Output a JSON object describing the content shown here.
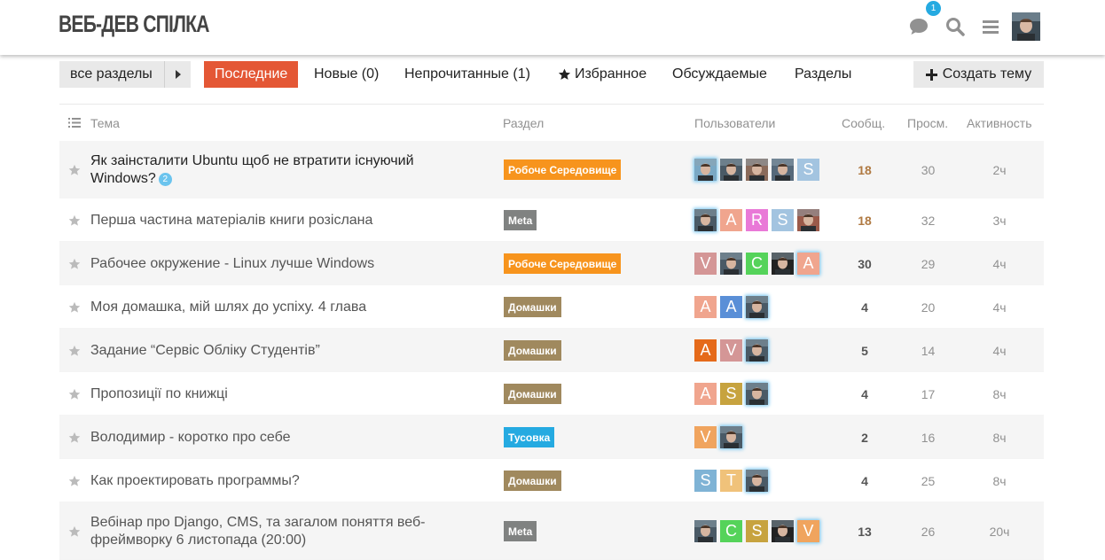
{
  "site": {
    "title": "ВЕБ-ДЕВ СПІЛКА",
    "notification_count": "1"
  },
  "nav": {
    "category_dropdown": "все разделы",
    "items": [
      {
        "label": "Последние",
        "active": true
      },
      {
        "label": "Новые (0)",
        "active": false
      },
      {
        "label": "Непрочитанные (1)",
        "active": false
      },
      {
        "label": "Избранное",
        "active": false
      },
      {
        "label": "Обсуждаемые",
        "active": false
      },
      {
        "label": "Разделы",
        "active": false
      }
    ],
    "create_topic": "Создать тему"
  },
  "table": {
    "headers": {
      "topic": "Тема",
      "category": "Раздел",
      "users": "Пользователи",
      "posts": "Сообщ.",
      "views": "Просм.",
      "activity": "Активность"
    },
    "rows": [
      {
        "title": "Як заінсталити Ubuntu щоб не втратити існуючий Windows?",
        "unread": "2",
        "category": "Робоче Середовище",
        "cat_color": "#f7941d",
        "users": [
          {
            "t": "photo",
            "c": "#7aa8c4",
            "hl": true
          },
          {
            "t": "photo",
            "c": "#4a5a66"
          },
          {
            "t": "photo",
            "c": "#8a6a5a"
          },
          {
            "t": "photo",
            "c": "#56697a"
          },
          {
            "t": "letter",
            "l": "S",
            "c": "#a3c4e0"
          }
        ],
        "posts": "18",
        "hot": true,
        "views": "30",
        "activity": "2ч"
      },
      {
        "title": "Перша частина матеріалів книги розіслана",
        "category": "Meta",
        "cat_color": "#808281",
        "users": [
          {
            "t": "photo",
            "c": "#4a5a66",
            "hl": true
          },
          {
            "t": "letter",
            "l": "A",
            "c": "#f0a58e"
          },
          {
            "t": "letter",
            "l": "R",
            "c": "#e979d7"
          },
          {
            "t": "letter",
            "l": "S",
            "c": "#a3c4e0"
          },
          {
            "t": "photo",
            "c": "#9a5a4a"
          }
        ],
        "posts": "18",
        "hot": true,
        "views": "32",
        "activity": "3ч"
      },
      {
        "title": "Рабочее окружение - Linux лучше Windows",
        "category": "Робоче Середовище",
        "cat_color": "#f7941d",
        "users": [
          {
            "t": "letter",
            "l": "V",
            "c": "#d49696"
          },
          {
            "t": "photo",
            "c": "#4a5a66"
          },
          {
            "t": "letter",
            "l": "C",
            "c": "#55d35a"
          },
          {
            "t": "photo",
            "c": "#222222"
          },
          {
            "t": "letter",
            "l": "A",
            "c": "#f0a58e",
            "hl": true
          }
        ],
        "posts": "30",
        "hot": false,
        "views": "29",
        "activity": "4ч"
      },
      {
        "title": "Моя домашка, мій шлях до успіху. 4 глава",
        "category": "Домашки",
        "cat_color": "#a0895e",
        "users": [
          {
            "t": "letter",
            "l": "A",
            "c": "#f0a58e"
          },
          {
            "t": "letter",
            "l": "A",
            "c": "#5a8fd7"
          },
          {
            "t": "photo",
            "c": "#4a5a66",
            "hl": true
          }
        ],
        "posts": "4",
        "hot": false,
        "views": "20",
        "activity": "4ч"
      },
      {
        "title": "Задание “Сервіс Обліку Студентів”",
        "category": "Домашки",
        "cat_color": "#a0895e",
        "users": [
          {
            "t": "letter",
            "l": "A",
            "c": "#e56a1a"
          },
          {
            "t": "letter",
            "l": "V",
            "c": "#d49696"
          },
          {
            "t": "photo",
            "c": "#4a5a66",
            "hl": true
          }
        ],
        "posts": "5",
        "hot": false,
        "views": "14",
        "activity": "4ч"
      },
      {
        "title": "Пропозиції по книжці",
        "category": "Домашки",
        "cat_color": "#a0895e",
        "users": [
          {
            "t": "letter",
            "l": "A",
            "c": "#f0a58e"
          },
          {
            "t": "letter",
            "l": "S",
            "c": "#c7a33f"
          },
          {
            "t": "photo",
            "c": "#4a5a66",
            "hl": true
          }
        ],
        "posts": "4",
        "hot": false,
        "views": "17",
        "activity": "8ч"
      },
      {
        "title": "Володимир - коротко про себе",
        "category": "Тусовка",
        "cat_color": "#25aae1",
        "users": [
          {
            "t": "letter",
            "l": "V",
            "c": "#f0a45e"
          },
          {
            "t": "photo",
            "c": "#4a5a66",
            "hl": true
          }
        ],
        "posts": "2",
        "hot": false,
        "views": "16",
        "activity": "8ч"
      },
      {
        "title": "Как проектировать программы?",
        "category": "Домашки",
        "cat_color": "#a0895e",
        "users": [
          {
            "t": "letter",
            "l": "S",
            "c": "#7fb3d5"
          },
          {
            "t": "letter",
            "l": "T",
            "c": "#f0c27a"
          },
          {
            "t": "photo",
            "c": "#4a5a66",
            "hl": true
          }
        ],
        "posts": "4",
        "hot": false,
        "views": "25",
        "activity": "8ч"
      },
      {
        "title": "Вебінар про Django, CMS, та загалом поняття веб-фреймворку 6 листопада (20:00)",
        "category": "Meta",
        "cat_color": "#808281",
        "users": [
          {
            "t": "photo",
            "c": "#4a5a66"
          },
          {
            "t": "letter",
            "l": "C",
            "c": "#55d35a"
          },
          {
            "t": "letter",
            "l": "S",
            "c": "#c7a33f"
          },
          {
            "t": "photo",
            "c": "#222222"
          },
          {
            "t": "letter",
            "l": "V",
            "c": "#f0a45e",
            "hl": true
          }
        ],
        "posts": "13",
        "hot": false,
        "views": "26",
        "activity": "20ч"
      }
    ]
  }
}
